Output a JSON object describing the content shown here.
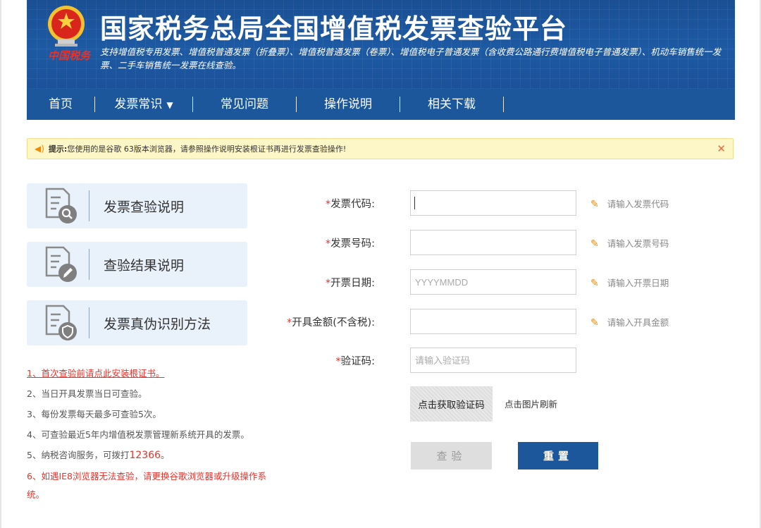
{
  "header": {
    "logo_text": "中国税务",
    "title": "国家税务总局全国增值税发票查验平台",
    "subtitle": "支持增值税专用发票、增值税普通发票（折叠票）、增值税普通发票（卷票）、增值税电子普通发票（含收费公路通行费增值税电子普通发票）、机动车销售统一发票、二手车销售统一发票在线查验。"
  },
  "nav": {
    "items": [
      {
        "label": "首页"
      },
      {
        "label": "发票常识"
      },
      {
        "label": "常见问题"
      },
      {
        "label": "操作说明"
      },
      {
        "label": "相关下载"
      }
    ]
  },
  "notice": {
    "label": "提示:",
    "text": "您使用的是谷歌 63版本浏览器，请参照操作说明安装根证书再进行发票查验操作!"
  },
  "cards": [
    {
      "label": "发票查验说明",
      "icon": "document-search-icon"
    },
    {
      "label": "查验结果说明",
      "icon": "document-edit-icon"
    },
    {
      "label": "发票真伪识别方法",
      "icon": "document-shield-icon"
    }
  ],
  "notes": {
    "n1": "1、首次查验前请点此安装根证书。",
    "n2": "2、当日开具发票当日可查验。",
    "n3": "3、每份发票每天最多可查验5次。",
    "n4": "4、可查验最近5年内增值税发票管理新系统开具的发票。",
    "n5_prefix": "5、纳税咨询服务，可拨打",
    "n5_hotline": "12366",
    "n5_suffix": "。",
    "n6": "6、如遇IE8浏览器无法查验，请更换谷歌浏览器或升级操作系统。"
  },
  "form": {
    "required_mark": "*",
    "code": {
      "label": "发票代码:",
      "value": "",
      "hint": "请输入发票代码"
    },
    "number": {
      "label": "发票号码:",
      "value": "",
      "hint": "请输入发票号码"
    },
    "date": {
      "label": "开票日期:",
      "placeholder": "YYYYMMDD",
      "hint": "请输入开票日期"
    },
    "amount": {
      "label": "开具金额(不含税):",
      "value": "",
      "hint": "请输入开具金额"
    },
    "captcha": {
      "label": "验证码:",
      "placeholder": "请输入验证码"
    },
    "captcha_image_text": "点击获取验证码",
    "captcha_refresh": "点击图片刷新",
    "submit_label": "查验",
    "reset_label": "重置"
  },
  "colors": {
    "header_blue": "#1c579c",
    "notice_bg": "#fdf6c7",
    "required_red": "#e8322a",
    "card_bg": "#e9f2fb"
  }
}
